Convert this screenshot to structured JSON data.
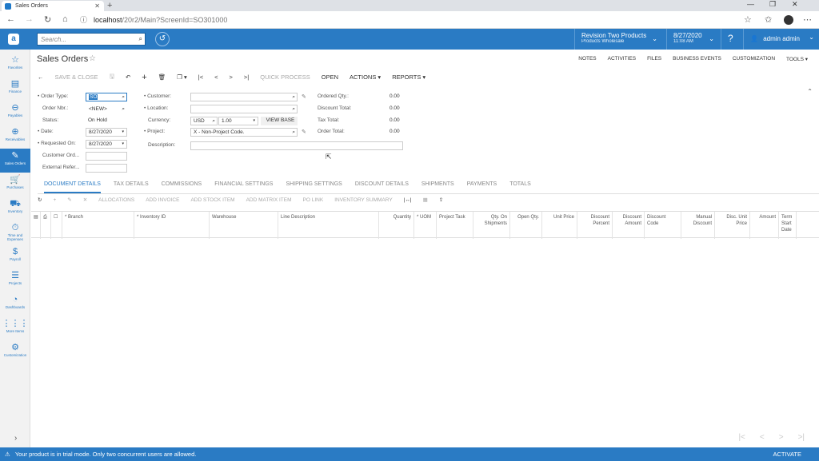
{
  "browser": {
    "tab_title": "Sales Orders",
    "url_host": "localhost",
    "url_path": "/20r2/Main?ScreenId=SO301000"
  },
  "header": {
    "search_placeholder": "Search...",
    "company_name": "Revision Two Products",
    "company_sub": "Products Wholesale",
    "date": "8/27/2020",
    "time": "11:08 AM",
    "user": "admin admin"
  },
  "sidebar": {
    "items": [
      {
        "label": "Favorites",
        "icon": "☆"
      },
      {
        "label": "Finance",
        "icon": "▤"
      },
      {
        "label": "Payables",
        "icon": "⊖"
      },
      {
        "label": "Receivables",
        "icon": "⊕"
      },
      {
        "label": "Sales Orders",
        "icon": "✎"
      },
      {
        "label": "Purchases",
        "icon": "🛒"
      },
      {
        "label": "Inventory",
        "icon": "⛟"
      },
      {
        "label": "Time and Expenses",
        "icon": "⏱"
      },
      {
        "label": "Payroll",
        "icon": "$"
      },
      {
        "label": "Projects",
        "icon": "☰"
      },
      {
        "label": "Dashboards",
        "icon": "◔"
      },
      {
        "label": "More Items",
        "icon": "⋮⋮⋮"
      },
      {
        "label": "Customization",
        "icon": "⚙"
      }
    ],
    "collapse": "›"
  },
  "page": {
    "title": "Sales Orders",
    "right_links": [
      "NOTES",
      "ACTIVITIES",
      "FILES",
      "BUSINESS EVENTS",
      "CUSTOMIZATION",
      "TOOLS ▾"
    ],
    "toolbar": [
      "SAVE & CLOSE",
      "QUICK PROCESS",
      "OPEN",
      "ACTIONS ▾",
      "REPORTS ▾"
    ]
  },
  "form": {
    "order_type_label": "Order Type:",
    "order_type": "SO",
    "order_nbr_label": "Order Nbr.:",
    "order_nbr": "<NEW>",
    "status_label": "Status:",
    "status": "On Hold",
    "date_label": "Date:",
    "date": "8/27/2020",
    "requested_label": "Requested On:",
    "requested": "8/27/2020",
    "customer_ord_label": "Customer Ord...",
    "external_ref_label": "External Refer...",
    "customer_label": "Customer:",
    "location_label": "Location:",
    "currency_label": "Currency:",
    "currency": "USD",
    "rate": "1.00",
    "view_base": "VIEW BASE",
    "project_label": "Project:",
    "project": "X - Non-Project Code.",
    "description_label": "Description:",
    "ordered_qty_label": "Ordered Qty.:",
    "ordered_qty": "0.00",
    "discount_total_label": "Discount Total:",
    "discount_total": "0.00",
    "tax_total_label": "Tax Total:",
    "tax_total": "0.00",
    "order_total_label": "Order Total:",
    "order_total": "0.00"
  },
  "tabs": [
    "DOCUMENT DETAILS",
    "TAX DETAILS",
    "COMMISSIONS",
    "FINANCIAL SETTINGS",
    "SHIPPING SETTINGS",
    "DISCOUNT DETAILS",
    "SHIPMENTS",
    "PAYMENTS",
    "TOTALS"
  ],
  "grid_toolbar": [
    "ALLOCATIONS",
    "ADD INVOICE",
    "ADD STOCK ITEM",
    "ADD MATRIX ITEM",
    "PO LINK",
    "INVENTORY SUMMARY"
  ],
  "columns": [
    "* Branch",
    "* Inventory ID",
    "Warehouse",
    "Line Description",
    "Quantity",
    "* UOM",
    "Project Task",
    "Qty. On Shipments",
    "Open Qty.",
    "Unit Price",
    "Discount Percent",
    "Discount Amount",
    "Discount Code",
    "Manual Discount",
    "Disc. Unit Price",
    "Amount",
    "Term Start Date"
  ],
  "footer": {
    "message": "Your product is in trial mode. Only two concurrent users are allowed.",
    "activate": "ACTIVATE"
  }
}
